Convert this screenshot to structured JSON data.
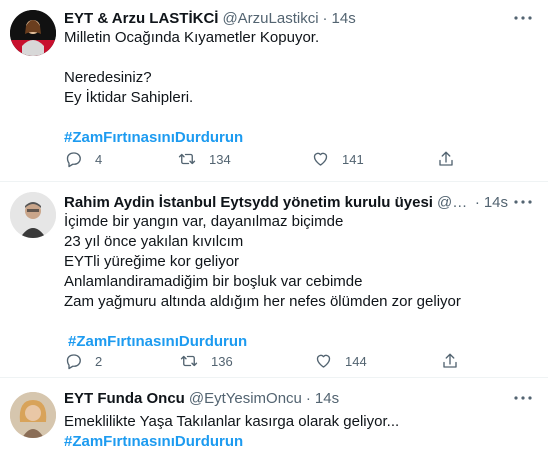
{
  "tweets": [
    {
      "name": "EYT & Arzu LASTİKCİ",
      "handle": "@ArzuLastikci",
      "time": "14s",
      "lines": [
        "Milletin Ocağında Kıyametler Kopuyor.",
        "",
        "Neredesiniz?",
        "Ey İktidar Sahipleri.",
        ""
      ],
      "hashtag": "#ZamFırtınasınıDurdurun",
      "replies": "4",
      "retweets": "134",
      "likes": "141"
    },
    {
      "name": "Rahim Aydin İstanbul Eytsydd yönetim kurulu üyesi",
      "handle": "@Rahim...",
      "time": "14s",
      "lines": [
        "İçimde bir yangın var, dayanılmaz biçimde",
        "23 yıl önce yakılan kıvılcım",
        "EYTli yüreğime kor geliyor",
        "Anlamlandiramadiğim bir boşluk var cebimde",
        "Zam yağmuru altında aldığım her nefes ölümden zor geliyor",
        ""
      ],
      "hashtag": "#ZamFırtınasınıDurdurun",
      "replies": "2",
      "retweets": "136",
      "likes": "144"
    },
    {
      "name": "EYT Funda Oncu",
      "handle": "@EytYesimOncu",
      "time": "14s",
      "lines": [
        "Emeklilikte Yaşa Takılanlar kasırga olarak geliyor..."
      ],
      "hashtag": "#ZamFırtınasınıDurdurun"
    }
  ],
  "colors": {
    "text": "#0f1419",
    "secondary": "#536471",
    "hashtag": "#1d9bf0",
    "divider": "#eff3f4"
  },
  "icons": [
    "reply-icon",
    "retweet-icon",
    "like-icon",
    "share-icon",
    "more-icon"
  ]
}
